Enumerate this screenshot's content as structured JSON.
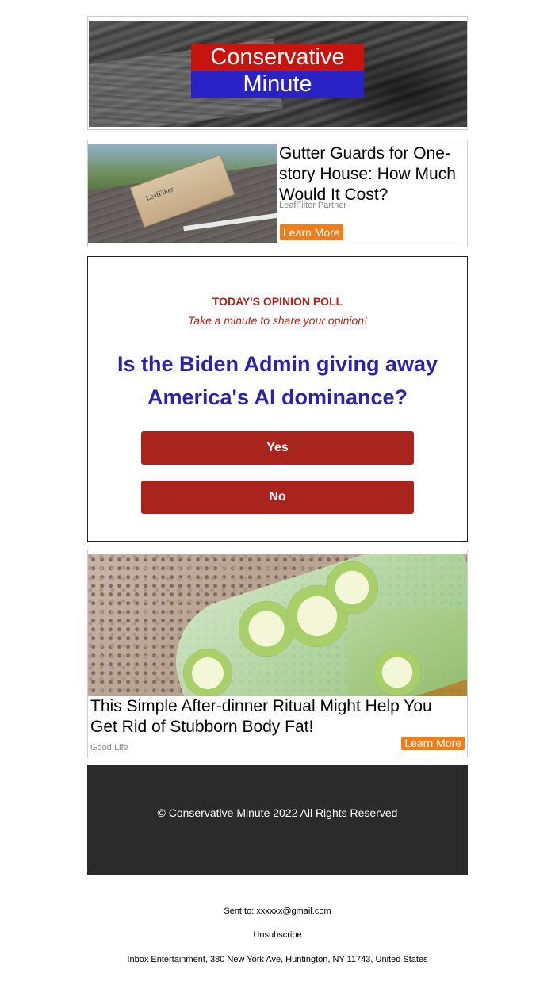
{
  "header": {
    "logo_line1": "Conservative",
    "logo_line2": "Minute"
  },
  "ad_top": {
    "title": "Gutter Guards for One-story House: How Much Would It Cost?",
    "source": "LeafFilter Partner",
    "cta": "Learn More",
    "image_box_label": "LeafFilter"
  },
  "poll": {
    "kicker": "TODAY'S OPINION POLL",
    "subtitle": "Take a minute to share your opinion!",
    "question": "Is the Biden Admin giving away America's AI dominance?",
    "options": [
      "Yes",
      "No"
    ]
  },
  "ad_bottom": {
    "title": "This Simple After-dinner Ritual Might Help You Get Rid of Stubborn Body Fat!",
    "source": "Good Life",
    "cta": "Learn More"
  },
  "footer": {
    "copyright": "© Conservative Minute 2022 All Rights Reserved"
  },
  "meta": {
    "sent_to": "Sent to: xxxxxx@gmail.com",
    "unsubscribe": "Unsubscribe",
    "address": "Inbox Entertainment, 380 New York Ave, Huntington, NY 11743, United States"
  },
  "colors": {
    "logo_red": "#c8140f",
    "logo_blue": "#2a22c4",
    "poll_red": "#a8241c",
    "poll_blue": "#2b22a8",
    "cta_orange": "#f07d1a",
    "footer_bg": "#2b2b2b"
  }
}
